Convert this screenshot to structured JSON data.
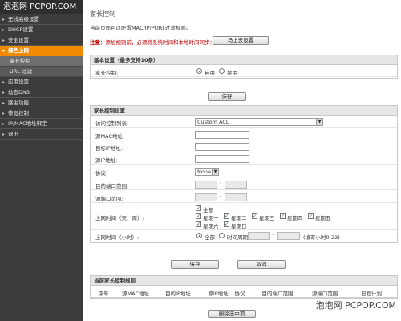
{
  "watermark": "泡泡网 PCPOP.COM",
  "sidebar": {
    "items": [
      {
        "label": "无线高级设置"
      },
      {
        "label": "DHCP设置"
      },
      {
        "label": "安全设置"
      },
      {
        "label": "绿色上网"
      },
      {
        "label": "家长控制"
      },
      {
        "label": "URL 过滤"
      },
      {
        "label": "应用设置"
      },
      {
        "label": "动态DNS"
      },
      {
        "label": "路由功能"
      },
      {
        "label": "带宽控制"
      },
      {
        "label": "IP/MAC地址绑定"
      },
      {
        "label": "退出"
      }
    ]
  },
  "page": {
    "title": "家长控制",
    "description": "当前页面可以配置MAC/IP/PORT过滤规则。",
    "notice_prefix": "注意：",
    "notice_text": "添加规则前，必须将系统时间和本地时间同步：",
    "sync_button": "马上去设置"
  },
  "basic": {
    "header": "基本设置（最多支持10条）",
    "parental_label": "家长控制:",
    "enable_label": "启用",
    "disable_label": "禁用",
    "save_button": "保存"
  },
  "control": {
    "header": "家长控制设置",
    "access_label": "访问控制列表:",
    "access_value": "Custom ACL",
    "src_mac_label": "源MAC地址:",
    "dst_ip_label": "目标IP地址:",
    "src_ip_label": "源IP地址:",
    "protocol_label": "协议:",
    "protocol_value": "None",
    "dst_port_label": "目的端口范围:",
    "src_port_label": "源端口范围:",
    "days_label": "上网时间（天、周）:",
    "day_all": "全部",
    "days": [
      "星期一",
      "星期二",
      "星期三",
      "星期四",
      "星期五",
      "星期六",
      "星期日"
    ],
    "hours_label": "上网时间（小时）:",
    "hours_all": "全部",
    "hours_period": "时间周期",
    "hours_hint": "(填写小时0-23)",
    "save_button": "保存",
    "cancel_button": "取消"
  },
  "rules": {
    "header": "当前家长控制规则",
    "columns": [
      "序号",
      "源MAC地址",
      "目的IP地址",
      "源IP地址",
      "协议",
      "目的端口范围",
      "源端口范围",
      "日程计划"
    ],
    "delete_button": "删除选中项"
  }
}
